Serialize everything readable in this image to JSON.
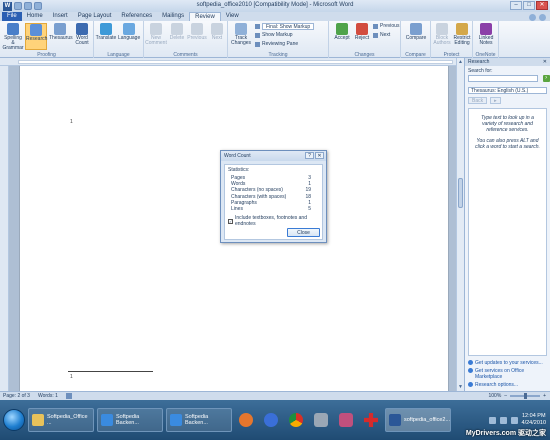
{
  "window": {
    "title": "softpedia_office2010 [Compatibility Mode] - Microsoft Word",
    "controls": [
      "–",
      "□",
      "✕"
    ]
  },
  "tabs": [
    {
      "label": "File"
    },
    {
      "label": "Home"
    },
    {
      "label": "Insert"
    },
    {
      "label": "Page Layout"
    },
    {
      "label": "References"
    },
    {
      "label": "Mailings"
    },
    {
      "label": "Review",
      "active": true
    },
    {
      "label": "View"
    }
  ],
  "ribbon": {
    "proofing": {
      "label": "Proofing",
      "spelling": "Spelling & Grammar",
      "research": "Research",
      "thesaurus": "Thesaurus",
      "word_count": "Word Count"
    },
    "language": {
      "label": "Language",
      "translate": "Translate",
      "language": "Language"
    },
    "comments": {
      "label": "Comments",
      "new": "New Comment",
      "delete": "Delete",
      "previous": "Previous",
      "next": "Next"
    },
    "tracking": {
      "label": "Tracking",
      "track_changes": "Track Changes",
      "display_for_review": "Final: Show Markup",
      "show_markup": "Show Markup",
      "reviewing_pane": "Reviewing Pane"
    },
    "changes": {
      "label": "Changes",
      "accept": "Accept",
      "reject": "Reject",
      "previous": "Previous",
      "next": "Next"
    },
    "compare": {
      "label": "Compare",
      "compare": "Compare"
    },
    "protect": {
      "label": "Protect",
      "block_authors": "Block Authors",
      "restrict_editing": "Restrict Editing"
    },
    "onenote": {
      "label": "OneNote",
      "linked_notes": "Linked Notes"
    }
  },
  "document": {
    "page_number_top": "1",
    "page_number_bottom": "1"
  },
  "research_pane": {
    "title": "Research",
    "close": "✕",
    "search_for_label": "Search for:",
    "search_value": "",
    "source": "Thesaurus: English (U.S.)",
    "back": "Back",
    "forward": "▸",
    "message1": "Type text to look up in a variety of research and reference services.",
    "message2": "You can also press ALT and click a word to start a search.",
    "links": [
      "Get updates to your services...",
      "Get services on Office Marketplace",
      "Research options..."
    ]
  },
  "word_count_dialog": {
    "title": "Word Count",
    "help": "?",
    "close_x": "✕",
    "statistics_label": "Statistics:",
    "stats": [
      {
        "label": "Pages",
        "value": "3"
      },
      {
        "label": "Words",
        "value": "1"
      },
      {
        "label": "Characters (no spaces)",
        "value": "19"
      },
      {
        "label": "Characters (with spaces)",
        "value": "18"
      },
      {
        "label": "Paragraphs",
        "value": "1"
      },
      {
        "label": "Lines",
        "value": "5"
      }
    ],
    "include_checkbox": "Include textboxes, footnotes and endnotes",
    "include_checked": true,
    "close_button": "Close"
  },
  "status_bar": {
    "page": "Page: 2 of 3",
    "words": "Words: 1",
    "zoom": "100%"
  },
  "taskbar": {
    "items": [
      {
        "label": "Softpedia_Office ...",
        "color": "#e8c25a"
      },
      {
        "label": "Softpedia Backen...",
        "color": "#3a8be0"
      },
      {
        "label": "Softpedia Backen...",
        "color": "#3a8be0"
      }
    ],
    "pinned": [
      {
        "name": "firefox-icon",
        "color": "#e5762d"
      },
      {
        "name": "player-icon",
        "color": "#3a6fd8"
      },
      {
        "name": "chrome-icon",
        "color": "#4caf50"
      },
      {
        "name": "utility-icon",
        "color": "#9aa7b5"
      },
      {
        "name": "app-icon",
        "color": "#c0507d"
      },
      {
        "name": "aid-icon",
        "color": "#d62b2b"
      }
    ],
    "word_task": "softpedia_office2...",
    "clock_time": "12:04 PM",
    "clock_date": "4/24/2010",
    "watermark": "MyDrivers.com 驱动之家"
  }
}
